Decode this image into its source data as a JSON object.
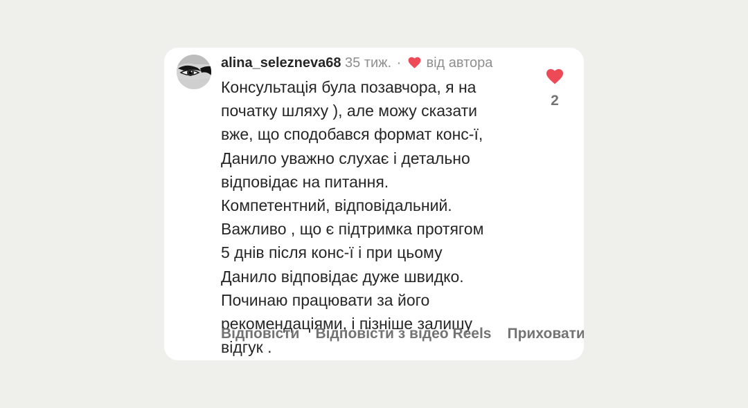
{
  "comment": {
    "username": "alina_selezneva68",
    "time": "35 тиж.",
    "separator": "·",
    "liked_by_author_label": "від автора",
    "text": "Консультація була позавчора, я на\nпочатку шляху ), але можу сказати\nвже, що сподобався формат конс-ї,\nДанило уважно слухає і детально\nвідповідає на питання.\nКомпетентний, відповідальний.\nВажливо , що є підтримка протягом\n5 днів після конс-ї і при цьому\nДанило відповідає дуже швидко.\nПочинаю працювати за його\nрекомендаціями, і пізніше залишу\nвідгук .",
    "like_count": "2",
    "actions": {
      "reply": "Відповісти",
      "reply_reels": "Відповісти з відео Reels",
      "hide": "Приховати"
    }
  },
  "colors": {
    "background": "#efefeb",
    "card": "#ffffff",
    "heart": "#ed4956",
    "text": "#262626",
    "muted": "#8e8e8e"
  },
  "icons": {
    "avatar": "eye-avatar",
    "author_heart": "heart-icon",
    "like": "heart-icon"
  }
}
